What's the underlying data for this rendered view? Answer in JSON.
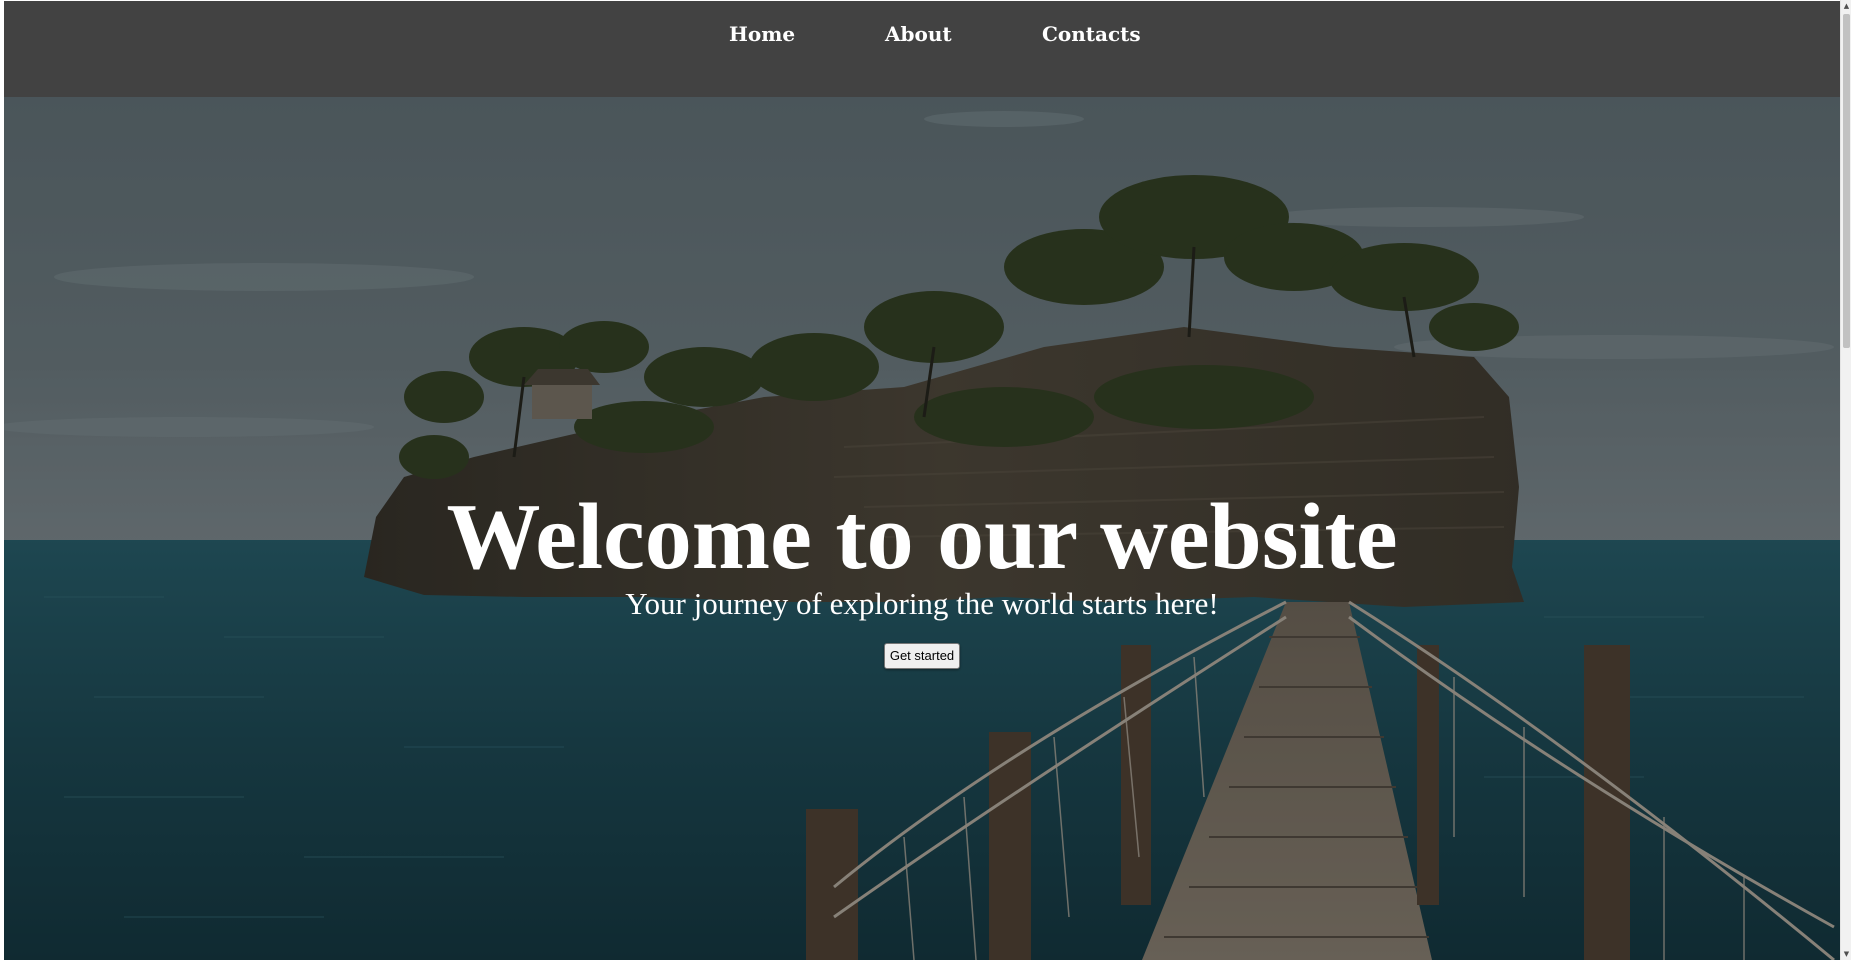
{
  "nav": {
    "items": [
      {
        "label": "Home"
      },
      {
        "label": "About"
      },
      {
        "label": "Contacts"
      }
    ]
  },
  "hero": {
    "title": "Welcome to our website",
    "subtitle": "Your journey of exploring the world starts here!",
    "cta_label": "Get started",
    "background_image": "island-with-rope-bridge-over-sea"
  },
  "scrollbar": {
    "up_icon": "scroll-up-arrow-icon",
    "down_icon": "scroll-down-arrow-icon"
  },
  "colors": {
    "navbar": "#424242",
    "nav_text": "#ffffff",
    "hero_text": "#ffffff",
    "sea": "#1f4a55",
    "sky": "#5f7078",
    "overlay": "rgba(0,0,0,0.35)"
  }
}
